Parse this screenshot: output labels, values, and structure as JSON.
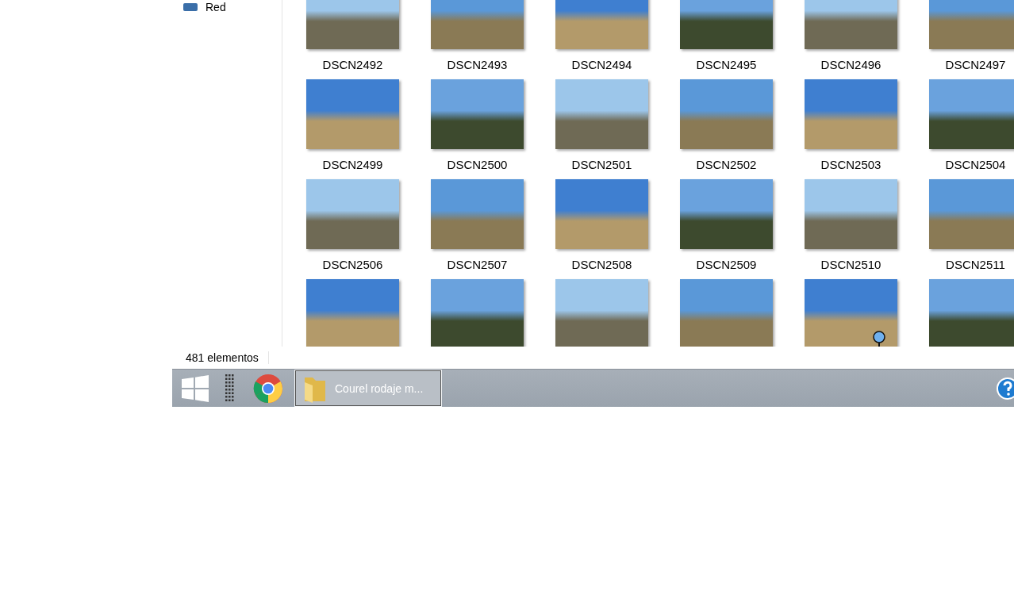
{
  "sidebar": {
    "items": [
      {
        "label": "Red"
      }
    ]
  },
  "files": [
    {
      "kind": "photo",
      "name": "DSCN2492"
    },
    {
      "kind": "photo",
      "name": "DSCN2493"
    },
    {
      "kind": "photo",
      "name": "DSCN2494"
    },
    {
      "kind": "photo",
      "name": "DSCN2495"
    },
    {
      "kind": "photo",
      "name": "DSCN2496"
    },
    {
      "kind": "photo",
      "name": "DSCN2497"
    },
    {
      "kind": "photo",
      "name": "DSCN2499"
    },
    {
      "kind": "photo",
      "name": "DSCN2500"
    },
    {
      "kind": "photo",
      "name": "DSCN2501"
    },
    {
      "kind": "photo",
      "name": "DSCN2502"
    },
    {
      "kind": "photo",
      "name": "DSCN2503"
    },
    {
      "kind": "photo",
      "name": "DSCN2504"
    },
    {
      "kind": "photo",
      "name": "DSCN2506"
    },
    {
      "kind": "photo",
      "name": "DSCN2507"
    },
    {
      "kind": "photo",
      "name": "DSCN2508"
    },
    {
      "kind": "photo",
      "name": "DSCN2509"
    },
    {
      "kind": "photo",
      "name": "DSCN2510"
    },
    {
      "kind": "photo",
      "name": "DSCN2511"
    },
    {
      "kind": "photo"
    },
    {
      "kind": "photo"
    },
    {
      "kind": "photo"
    },
    {
      "kind": "photo"
    },
    {
      "kind": "photo"
    },
    {
      "kind": "photo"
    }
  ],
  "status_bar": {
    "item_count": "481 elementos"
  },
  "taskbar": {
    "items": [
      {
        "kind": "start"
      },
      {
        "kind": "task-view"
      },
      {
        "kind": "chrome"
      },
      {
        "kind": "folder",
        "label": "Courel rodaje m...",
        "selected": true
      },
      {
        "kind": "help"
      }
    ]
  }
}
